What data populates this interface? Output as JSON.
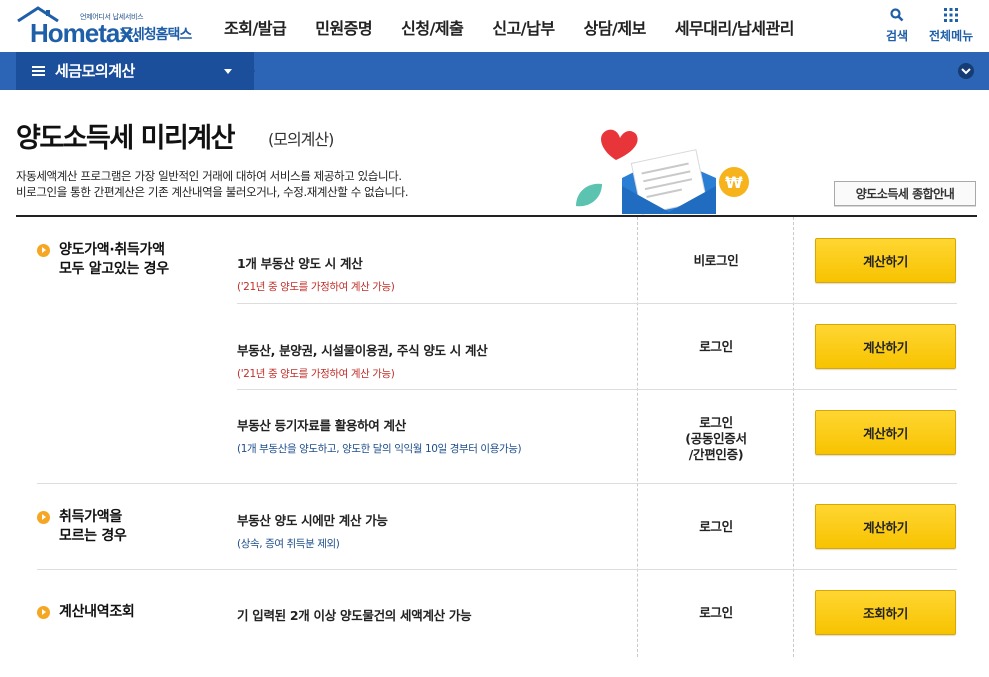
{
  "header": {
    "logo_small": "언제어디서 납세서비스",
    "logo_main": "Hometax.",
    "logo_sub": "국세청홈택스",
    "menu": [
      "조회/발급",
      "민원증명",
      "신청/제출",
      "신고/납부",
      "상담/제보",
      "세무대리/납세관리"
    ],
    "search_label": "검색",
    "all_menu_label": "전체메뉴"
  },
  "bar": {
    "title": "세금모의계산"
  },
  "page": {
    "title": "양도소득세 미리계산",
    "subtitle": "(모의계산)",
    "intro_line1": "자동세액계산 프로그램은 가장 일반적인 거래에 대하여 서비스를 제공하고 있습니다.",
    "intro_line2": "비로그인을 통한 간편계산은 기존 계산내역을 불러오거나, 수정.재계산할 수 없습니다.",
    "guide_button": "양도소득세 종합안내"
  },
  "table": {
    "categories": [
      {
        "line1": "양도가액·취득가액",
        "line2": "모두 알고있는 경우"
      },
      {
        "line1": "취득가액을",
        "line2": "모르는 경우"
      },
      {
        "line1": "계산내역조회",
        "line2": ""
      }
    ],
    "rows": [
      {
        "main": "1개 부동산 양도 시 계산",
        "note": "('21년 중 양도를 가정하여 계산 가능)",
        "auth1": "비로그인",
        "auth2": "",
        "auth3": "",
        "button": "계산하기"
      },
      {
        "main": "부동산, 분양권, 시설물이용권, 주식 양도 시 계산",
        "note": "('21년 중 양도를 가정하여 계산 가능)",
        "auth1": "로그인",
        "auth2": "",
        "auth3": "",
        "button": "계산하기"
      },
      {
        "main": "부동산 등기자료를 활용하여 계산",
        "note": "(1개 부동산을 양도하고, 양도한 달의 익익월 10일 경부터 이용가능)",
        "auth1": "로그인",
        "auth2": "(공동인증서",
        "auth3": "/간편인증)",
        "button": "계산하기"
      },
      {
        "main": "부동산 양도 시에만 계산 가능",
        "note": "(상속, 증여 취득분 제외)",
        "auth1": "로그인",
        "auth2": "",
        "auth3": "",
        "button": "계산하기"
      },
      {
        "main": "기 입력된 2개 이상 양도물건의 세액계산 가능",
        "note": "",
        "auth1": "로그인",
        "auth2": "",
        "auth3": "",
        "button": "조회하기"
      }
    ]
  },
  "colors": {
    "brand_blue": "#1f5ea8",
    "bar_blue": "#2c64b6",
    "button_yellow": "#ffcc11",
    "bullet_orange": "#f5a623",
    "note_red": "#c0302b"
  },
  "icons": [
    "search-icon",
    "grid-menu-icon",
    "hamburger-icon",
    "chevron-down-icon",
    "heart-icon",
    "envelope-icon",
    "won-coin-icon",
    "leaf-icon"
  ]
}
